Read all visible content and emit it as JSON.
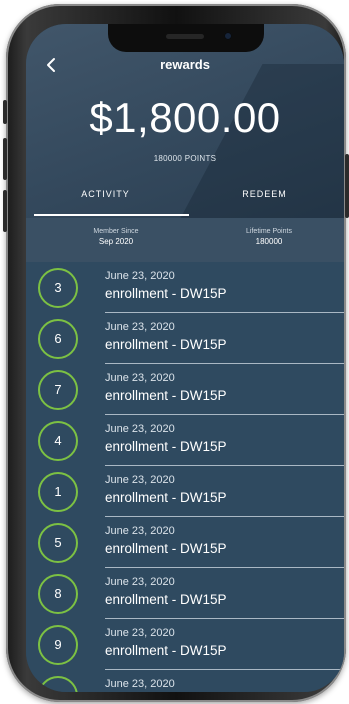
{
  "header": {
    "title": "rewards",
    "back_icon": "chevron-left-icon",
    "amount": "$1,800.00",
    "points": "180000 POINTS"
  },
  "tabs": [
    {
      "label": "ACTIVITY",
      "active": true
    },
    {
      "label": "REDEEM",
      "active": false
    }
  ],
  "stats": {
    "member_since_label": "Member Since",
    "member_since_value": "Sep 2020",
    "lifetime_label": "Lifetime Points",
    "lifetime_value": "180000"
  },
  "activity": [
    {
      "badge": "3",
      "date": "June 23, 2020",
      "desc": "enrollment - DW15P"
    },
    {
      "badge": "6",
      "date": "June 23, 2020",
      "desc": "enrollment - DW15P"
    },
    {
      "badge": "7",
      "date": "June 23, 2020",
      "desc": "enrollment - DW15P"
    },
    {
      "badge": "4",
      "date": "June 23, 2020",
      "desc": "enrollment - DW15P"
    },
    {
      "badge": "1",
      "date": "June 23, 2020",
      "desc": "enrollment - DW15P"
    },
    {
      "badge": "5",
      "date": "June 23, 2020",
      "desc": "enrollment - DW15P"
    },
    {
      "badge": "8",
      "date": "June 23, 2020",
      "desc": "enrollment - DW15P"
    },
    {
      "badge": "9",
      "date": "June 23, 2020",
      "desc": "enrollment - DW15P"
    },
    {
      "badge": "",
      "date": "June 23, 2020",
      "desc": ""
    }
  ],
  "colors": {
    "badge_ring": "#7cc143",
    "list_bg": "#2f4a60",
    "header_bg": "#41566a"
  }
}
